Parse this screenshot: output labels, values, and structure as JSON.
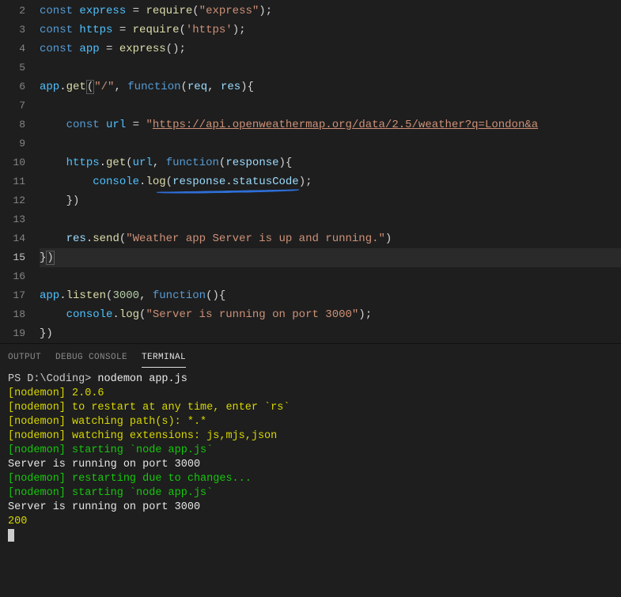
{
  "editor": {
    "active_line": 15,
    "lines": {
      "2": [
        [
          "k-const",
          "const"
        ],
        [
          "k-punc",
          " "
        ],
        [
          "k-var",
          "express"
        ],
        [
          "k-punc",
          " "
        ],
        [
          "k-op",
          "="
        ],
        [
          "k-punc",
          " "
        ],
        [
          "k-func",
          "require"
        ],
        [
          "k-punc",
          "("
        ],
        [
          "k-str",
          "\"express\""
        ],
        [
          "k-punc",
          ");"
        ]
      ],
      "3": [
        [
          "k-const",
          "const"
        ],
        [
          "k-punc",
          " "
        ],
        [
          "k-var",
          "https"
        ],
        [
          "k-punc",
          " "
        ],
        [
          "k-op",
          "="
        ],
        [
          "k-punc",
          " "
        ],
        [
          "k-func",
          "require"
        ],
        [
          "k-punc",
          "("
        ],
        [
          "k-str",
          "'https'"
        ],
        [
          "k-punc",
          ");"
        ]
      ],
      "4": [
        [
          "k-const",
          "const"
        ],
        [
          "k-punc",
          " "
        ],
        [
          "k-var",
          "app"
        ],
        [
          "k-punc",
          " "
        ],
        [
          "k-op",
          "="
        ],
        [
          "k-punc",
          " "
        ],
        [
          "k-func",
          "express"
        ],
        [
          "k-punc",
          "();"
        ]
      ],
      "5": [],
      "6": [
        [
          "k-var",
          "app"
        ],
        [
          "k-punc",
          "."
        ],
        [
          "k-func",
          "get"
        ],
        [
          "bracket-open",
          "("
        ],
        [
          "k-str",
          "\"/\""
        ],
        [
          "k-punc",
          ", "
        ],
        [
          "k-key",
          "function"
        ],
        [
          "k-punc",
          "("
        ],
        [
          "k-param",
          "req"
        ],
        [
          "k-punc",
          ", "
        ],
        [
          "k-param",
          "res"
        ],
        [
          "k-punc",
          "){"
        ]
      ],
      "7": [],
      "8": [
        [
          "k-punc",
          "    "
        ],
        [
          "k-const",
          "const"
        ],
        [
          "k-punc",
          " "
        ],
        [
          "k-var",
          "url"
        ],
        [
          "k-punc",
          " "
        ],
        [
          "k-op",
          "="
        ],
        [
          "k-punc",
          " "
        ],
        [
          "k-str",
          "\""
        ],
        [
          "k-url",
          "https://api.openweathermap.org/data/2.5/weather?q=London&a"
        ]
      ],
      "9": [],
      "10": [
        [
          "k-punc",
          "    "
        ],
        [
          "k-var",
          "https"
        ],
        [
          "k-punc",
          "."
        ],
        [
          "k-func",
          "get"
        ],
        [
          "k-punc",
          "("
        ],
        [
          "k-var",
          "url"
        ],
        [
          "k-punc",
          ", "
        ],
        [
          "k-key",
          "function"
        ],
        [
          "k-punc",
          "("
        ],
        [
          "k-param",
          "response"
        ],
        [
          "k-punc",
          "){"
        ]
      ],
      "11": [
        [
          "k-punc",
          "        "
        ],
        [
          "k-var",
          "console"
        ],
        [
          "k-punc",
          "."
        ],
        [
          "k-func",
          "log"
        ],
        [
          "k-punc",
          "("
        ],
        [
          "k-param",
          "response"
        ],
        [
          "k-punc",
          "."
        ],
        [
          "k-prop",
          "statusCode"
        ],
        [
          "k-punc",
          ");"
        ]
      ],
      "12": [
        [
          "k-punc",
          "    })"
        ]
      ],
      "13": [],
      "14": [
        [
          "k-punc",
          "    "
        ],
        [
          "k-param",
          "res"
        ],
        [
          "k-punc",
          "."
        ],
        [
          "k-func",
          "send"
        ],
        [
          "k-punc",
          "("
        ],
        [
          "k-str",
          "\"Weather app Server is up and running.\""
        ],
        [
          "k-punc",
          ")"
        ]
      ],
      "15": [
        [
          "k-punc",
          "}"
        ],
        [
          "bracket-close",
          ")"
        ]
      ],
      "16": [],
      "17": [
        [
          "k-var",
          "app"
        ],
        [
          "k-punc",
          "."
        ],
        [
          "k-func",
          "listen"
        ],
        [
          "k-punc",
          "("
        ],
        [
          "k-num",
          "3000"
        ],
        [
          "k-punc",
          ", "
        ],
        [
          "k-key",
          "function"
        ],
        [
          "k-punc",
          "(){"
        ]
      ],
      "18": [
        [
          "k-punc",
          "    "
        ],
        [
          "k-var",
          "console"
        ],
        [
          "k-punc",
          "."
        ],
        [
          "k-func",
          "log"
        ],
        [
          "k-punc",
          "("
        ],
        [
          "k-str",
          "\"Server is running on port 3000\""
        ],
        [
          "k-punc",
          ");"
        ]
      ],
      "19": [
        [
          "k-punc",
          "})"
        ]
      ]
    },
    "line_numbers": [
      2,
      3,
      4,
      5,
      6,
      7,
      8,
      9,
      10,
      11,
      12,
      13,
      14,
      15,
      16,
      17,
      18,
      19
    ]
  },
  "panel": {
    "tabs": {
      "output": "OUTPUT",
      "debug": "DEBUG CONSOLE",
      "terminal": "TERMINAL"
    },
    "active_tab": "terminal"
  },
  "terminal": {
    "prompt_path": "PS D:\\Coding> ",
    "command": "nodemon app.js",
    "lines": [
      {
        "cls": "t-yellow",
        "text": "[nodemon] 2.0.6"
      },
      {
        "cls": "t-yellow",
        "text": "[nodemon] to restart at any time, enter `rs`"
      },
      {
        "cls": "t-yellow",
        "text": "[nodemon] watching path(s): *.*"
      },
      {
        "cls": "t-yellow",
        "text": "[nodemon] watching extensions: js,mjs,json"
      },
      {
        "cls": "t-green",
        "text": "[nodemon] starting `node app.js`"
      },
      {
        "cls": "t-white",
        "text": "Server is running on port 3000"
      },
      {
        "cls": "t-green",
        "text": "[nodemon] restarting due to changes..."
      },
      {
        "cls": "t-green",
        "text": "[nodemon] starting `node app.js`"
      },
      {
        "cls": "t-white",
        "text": "Server is running on port 3000"
      },
      {
        "cls": "t-yellow",
        "text": "200"
      }
    ]
  }
}
